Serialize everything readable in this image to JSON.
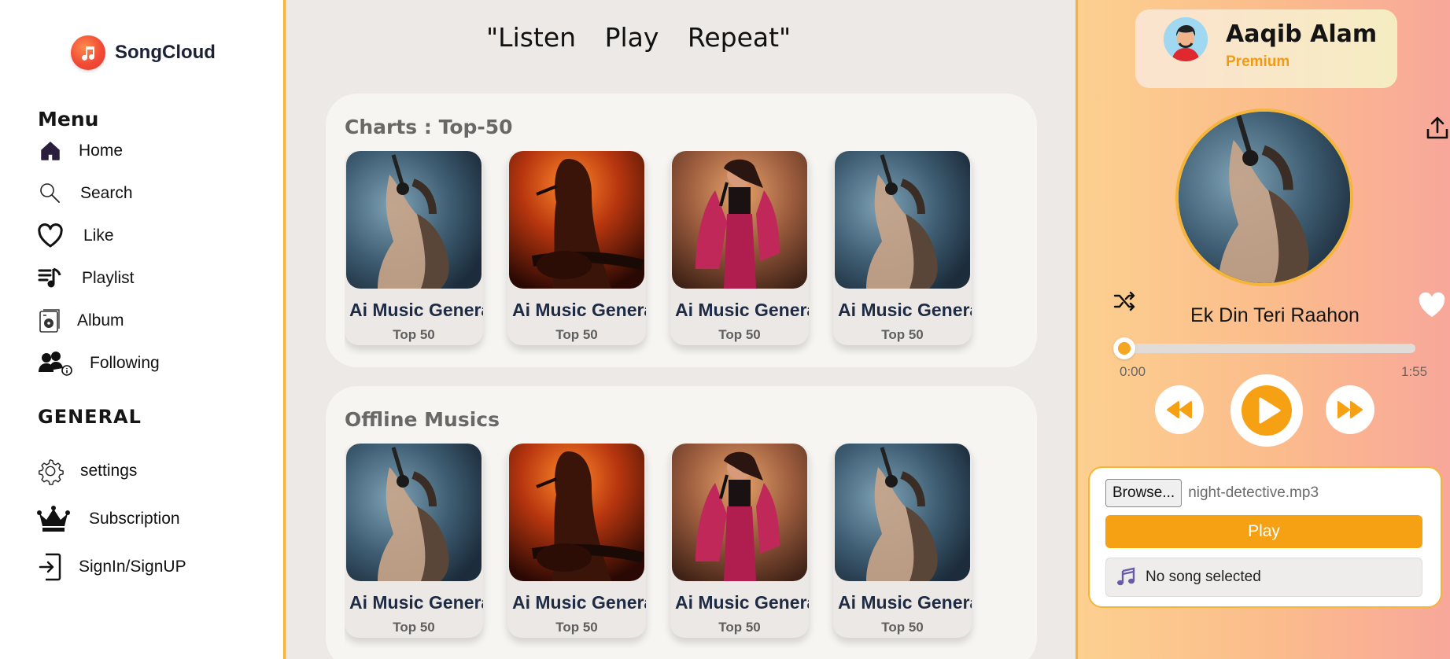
{
  "app": {
    "name": "SongCloud"
  },
  "sidebar": {
    "menu_title": "Menu",
    "menu_items": [
      {
        "label": "Home",
        "icon": "home-icon"
      },
      {
        "label": "Search",
        "icon": "search-icon"
      },
      {
        "label": "Like",
        "icon": "heart-icon"
      },
      {
        "label": "Playlist",
        "icon": "playlist-icon"
      },
      {
        "label": "Album",
        "icon": "album-icon"
      },
      {
        "label": "Following",
        "icon": "following-icon"
      }
    ],
    "general_title": "GENERAL",
    "general_items": [
      {
        "label": "settings",
        "icon": "gear-icon"
      },
      {
        "label": "Subscription",
        "icon": "crown-icon"
      },
      {
        "label": "SignIn/SignUP",
        "icon": "signin-icon"
      }
    ]
  },
  "header": {
    "tagline": "\"Listen Play Repeat\""
  },
  "sections": [
    {
      "title": "Charts : Top-50",
      "cards": [
        {
          "title": "Ai Music Generator",
          "subtitle": "Top 50",
          "art": "blue-singer"
        },
        {
          "title": "Ai Music Generator",
          "subtitle": "Top 50",
          "art": "orange-guitarist"
        },
        {
          "title": "Ai Music Generator",
          "subtitle": "Top 50",
          "art": "pink-singer"
        },
        {
          "title": "Ai Music Generator",
          "subtitle": "Top 50",
          "art": "blue-singer"
        }
      ]
    },
    {
      "title": "Offline Musics",
      "cards": [
        {
          "title": "Ai Music Generator",
          "subtitle": "Top 50",
          "art": "blue-singer"
        },
        {
          "title": "Ai Music Generator",
          "subtitle": "Top 50",
          "art": "orange-guitarist"
        },
        {
          "title": "Ai Music Generator",
          "subtitle": "Top 50",
          "art": "pink-singer"
        },
        {
          "title": "Ai Music Generator",
          "subtitle": "Top 50",
          "art": "blue-singer"
        }
      ]
    }
  ],
  "profile": {
    "name": "Aaqib Alam",
    "tier": "Premium"
  },
  "player": {
    "song_title": "Ek Din Teri Raahon",
    "current_time": "0:00",
    "total_time": "1:55",
    "progress": 0
  },
  "uploader": {
    "browse_label": "Browse...",
    "file_name": "night-detective.mp3",
    "play_label": "Play",
    "status": "No song selected"
  },
  "colors": {
    "accent": "#f6a114",
    "sidebar_border": "#f6b23a",
    "brand": "#f14b36"
  }
}
